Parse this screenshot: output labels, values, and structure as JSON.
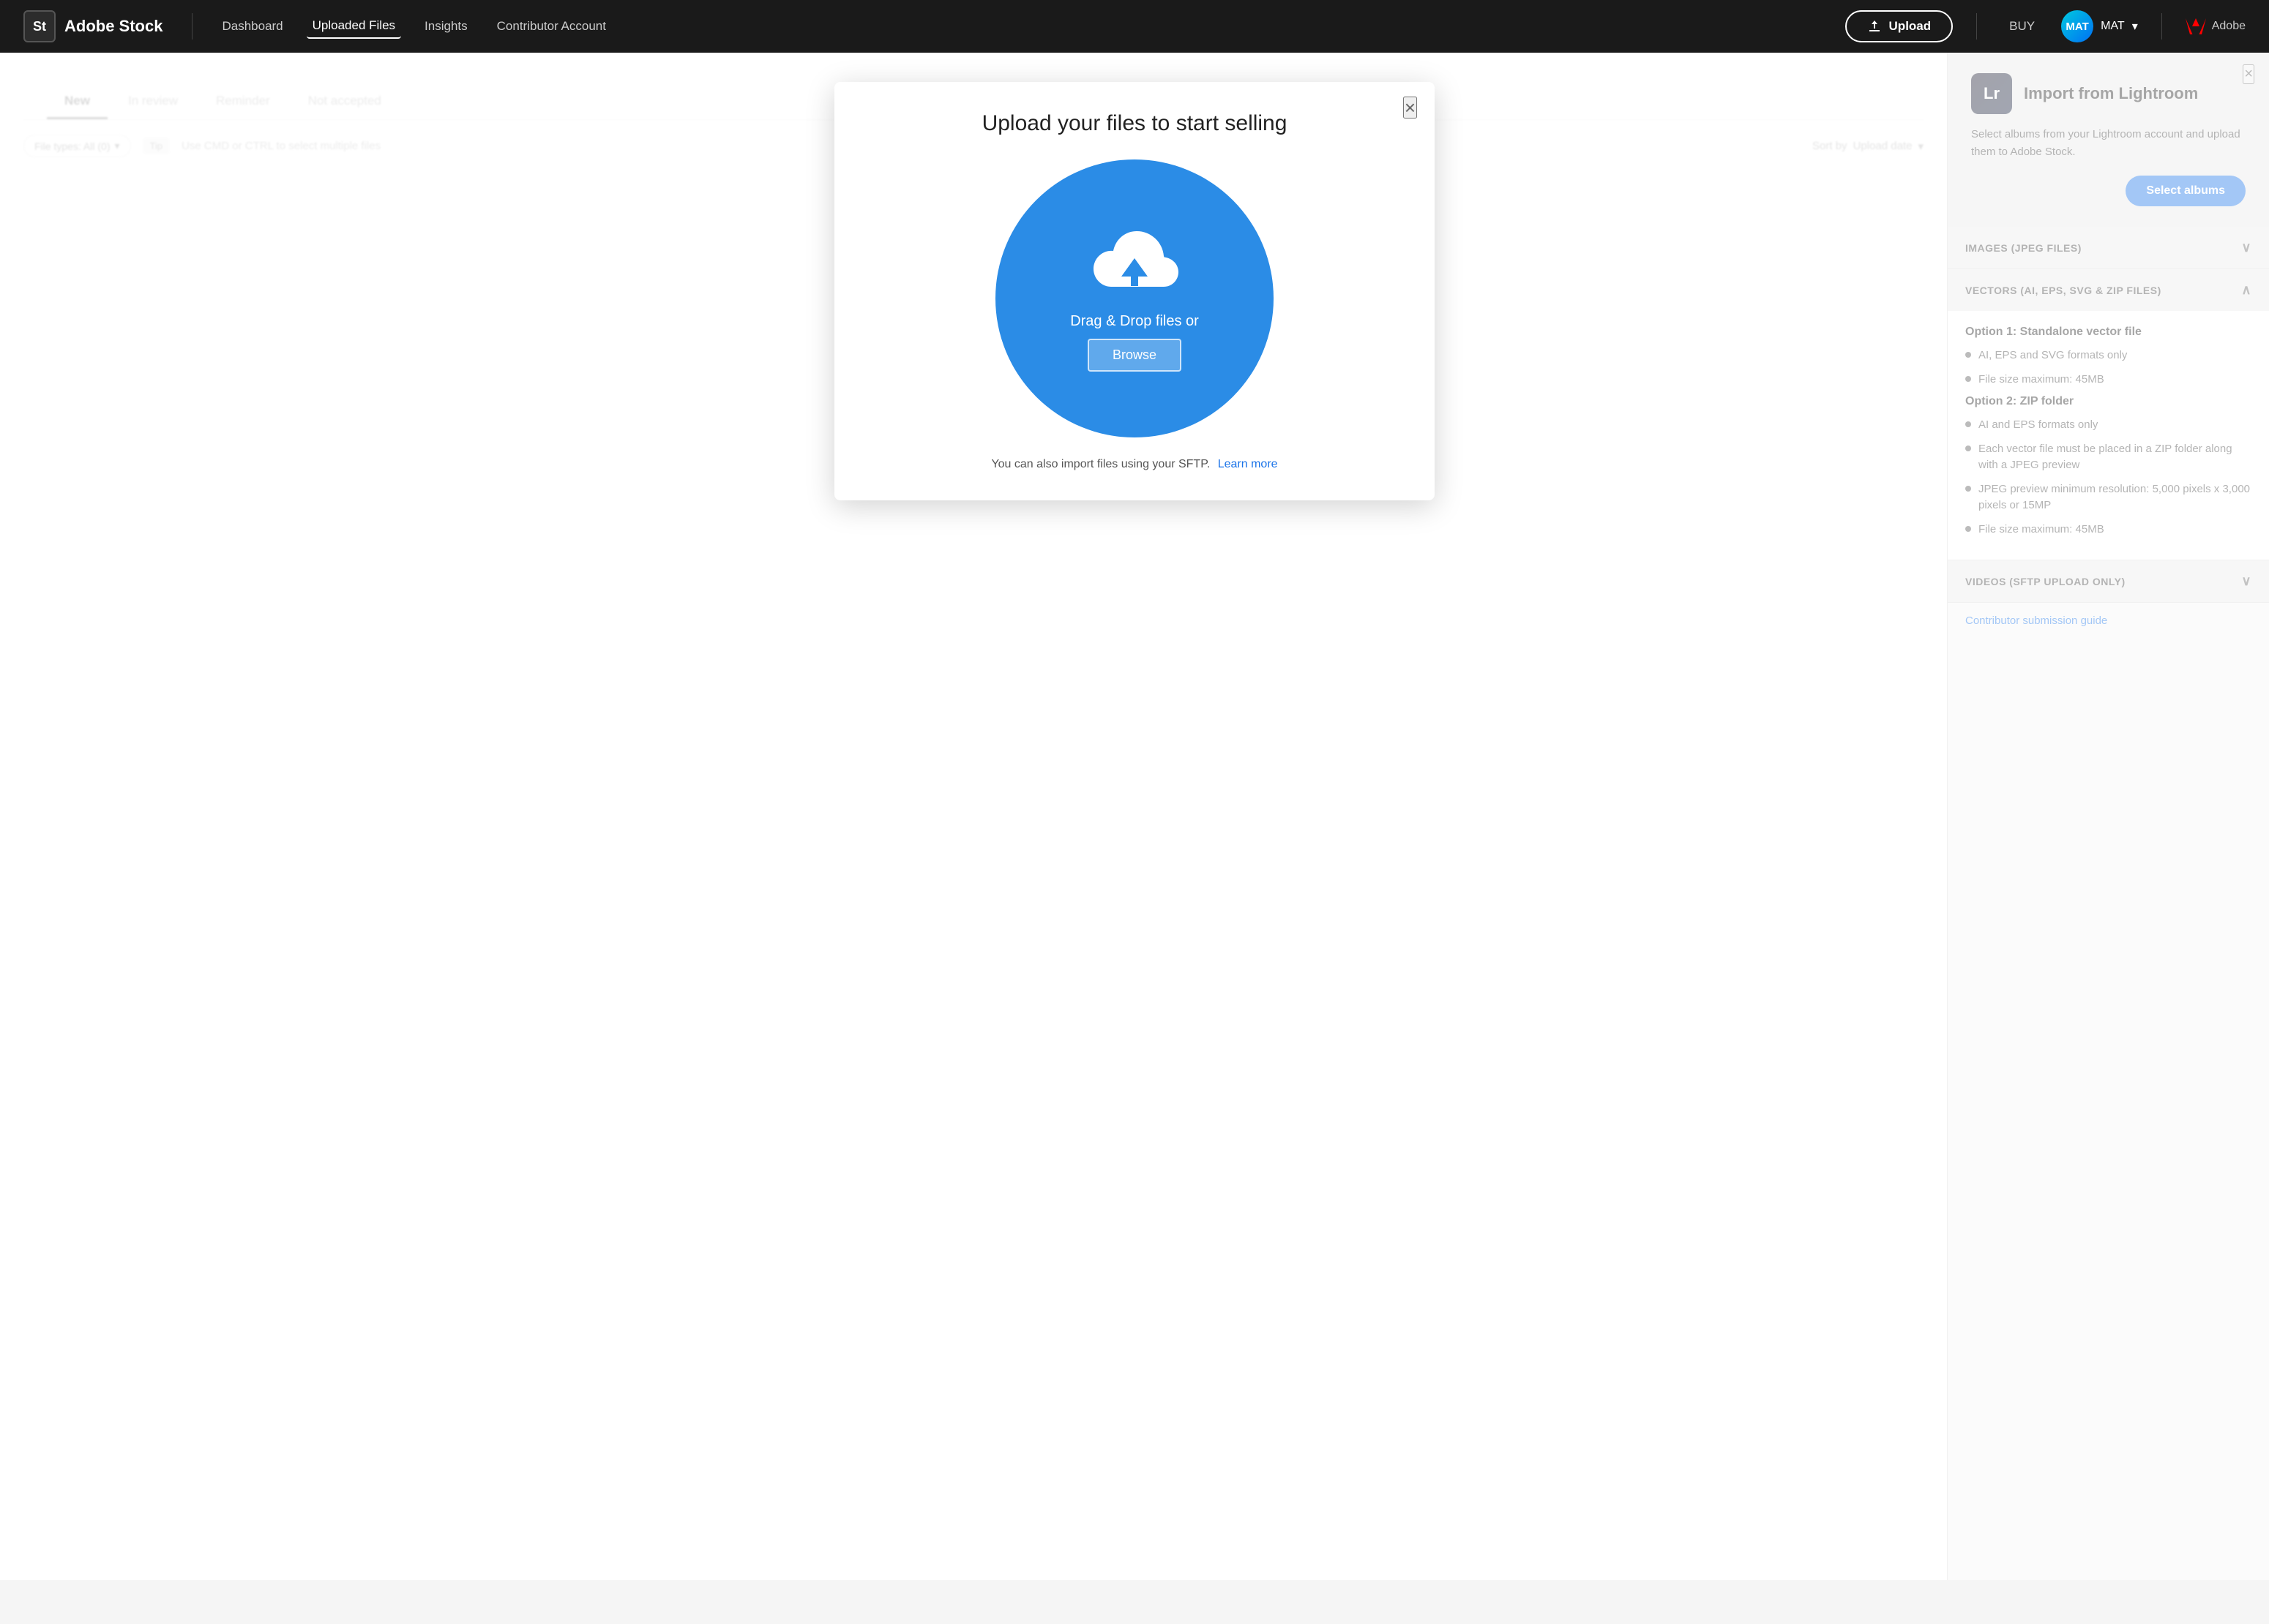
{
  "app": {
    "logo_text": "St",
    "brand_name": "Adobe Stock"
  },
  "navbar": {
    "links": [
      {
        "id": "dashboard",
        "label": "Dashboard",
        "active": false
      },
      {
        "id": "uploaded-files",
        "label": "Uploaded Files",
        "active": true
      },
      {
        "id": "insights",
        "label": "Insights",
        "active": false
      },
      {
        "id": "contributor-account",
        "label": "Contributor Account",
        "active": false
      }
    ],
    "upload_button": "Upload",
    "buy_link": "BUY",
    "user_name": "MAT",
    "adobe_label": "Adobe"
  },
  "tabs": {
    "items": [
      {
        "id": "new",
        "label": "New",
        "active": true
      },
      {
        "id": "in-review",
        "label": "In review",
        "active": false
      },
      {
        "id": "reminder",
        "label": "Reminder",
        "active": false
      },
      {
        "id": "not-accepted",
        "label": "Not accepted",
        "active": false
      }
    ],
    "file_types_label": "File types: All (0)",
    "tip_label": "Tip",
    "tip_text": "Use CMD or CTRL to select multiple files",
    "sort_label": "Sort by",
    "sort_value": "Upload date"
  },
  "upload_modal": {
    "title": "Upload your files to start selling",
    "close_label": "×",
    "drag_drop_text": "Drag & Drop files or",
    "browse_label": "Browse",
    "footer_text": "You can also import files using your SFTP.",
    "learn_more_label": "Learn more"
  },
  "lightroom_card": {
    "icon_text": "Lr",
    "title": "Import from Lightroom",
    "description": "Select albums from your Lightroom account and upload them to Adobe Stock.",
    "select_albums_label": "Select albums",
    "close_label": "×"
  },
  "accordion": {
    "sections": [
      {
        "id": "images",
        "title": "IMAGES (JPEG FILES)",
        "expanded": false,
        "content": []
      },
      {
        "id": "vectors",
        "title": "VECTORS (AI, EPS, SVG & ZIP FILES)",
        "expanded": true,
        "options": [
          {
            "title": "Option 1: Standalone vector file",
            "bullets": [
              "AI, EPS and SVG formats only",
              "File size maximum: 45MB"
            ]
          },
          {
            "title": "Option 2: ZIP folder",
            "bullets": [
              "AI and EPS formats only",
              "Each vector file must be placed in a ZIP folder along with a JPEG preview",
              "JPEG preview minimum resolution: 5,000 pixels x 3,000 pixels or 15MP",
              "File size maximum: 45MB"
            ]
          }
        ]
      },
      {
        "id": "videos",
        "title": "VIDEOS (SFTP UPLOAD ONLY)",
        "expanded": false,
        "content": []
      }
    ],
    "contributor_link_label": "Contributor submission guide"
  }
}
